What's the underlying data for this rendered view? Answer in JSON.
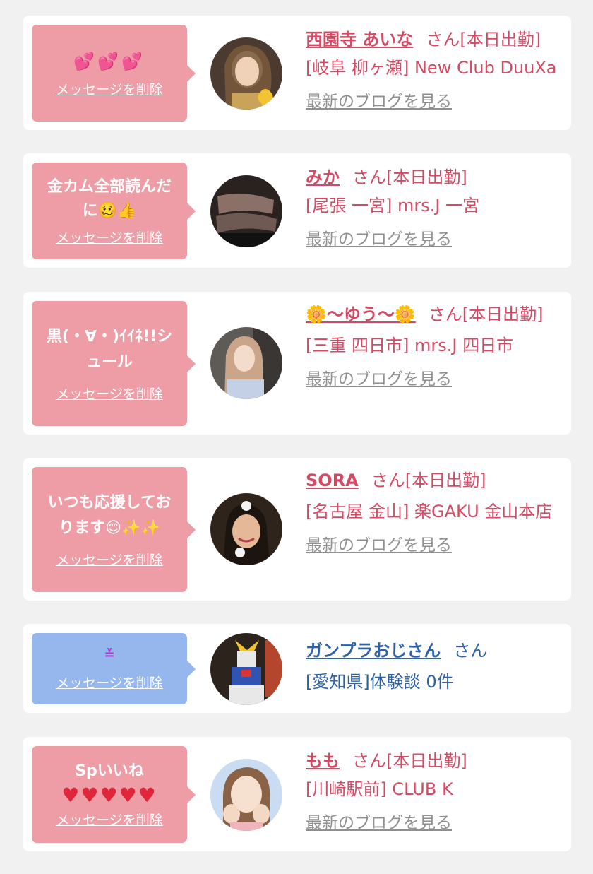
{
  "delete_label": "メッセージを削除",
  "blog_label": "最新のブログを見る",
  "san_suffix": "さん",
  "cards": [
    {
      "message": "💕💕💕",
      "name": "西園寺 あいな",
      "status": "さん[本日出勤]",
      "store": "[岐阜 柳ヶ瀬] New Club DuuXa",
      "avatar_icon": "woman-avatar-icon"
    },
    {
      "message": "金カム全部読んだに🥴👍",
      "name": "みか",
      "status": "さん[本日出勤]",
      "store": "[尾張 一宮] mrs.J 一宮",
      "avatar_icon": "legs-avatar-icon"
    },
    {
      "message": "黒(・∀・)ｲｲﾈ!!シュール",
      "name": "🌼〜ゆう〜🌼",
      "status": "さん[本日出勤]",
      "store": "[三重 四日市] mrs.J 四日市",
      "avatar_icon": "woman-car-avatar-icon"
    },
    {
      "message": "いつも応援しております😊✨✨",
      "name": "SORA",
      "status": "さん[本日出勤]",
      "store": "[名古屋 金山] 楽GAKU 金山本店",
      "avatar_icon": "bunny-filter-avatar-icon"
    },
    {
      "message": "≚",
      "name": "ガンプラおじさん",
      "status": "さん",
      "store": "[愛知県]体験談 0件",
      "avatar_icon": "gundam-avatar-icon"
    },
    {
      "message_title": "Spいいね",
      "message": "♥♥♥♥♥",
      "name": "もも",
      "status": "さん[本日出勤]",
      "store": "[川崎駅前] CLUB K",
      "avatar_icon": "woman-hands-avatar-icon"
    }
  ],
  "colors": {
    "pink_bubble": "#ee9ca6",
    "blue_bubble": "#96b6ee",
    "pink_text": "#d44a63",
    "blue_text": "#2e62a8",
    "blog_link": "#8f8f8f",
    "background": "#f1f1f1"
  }
}
